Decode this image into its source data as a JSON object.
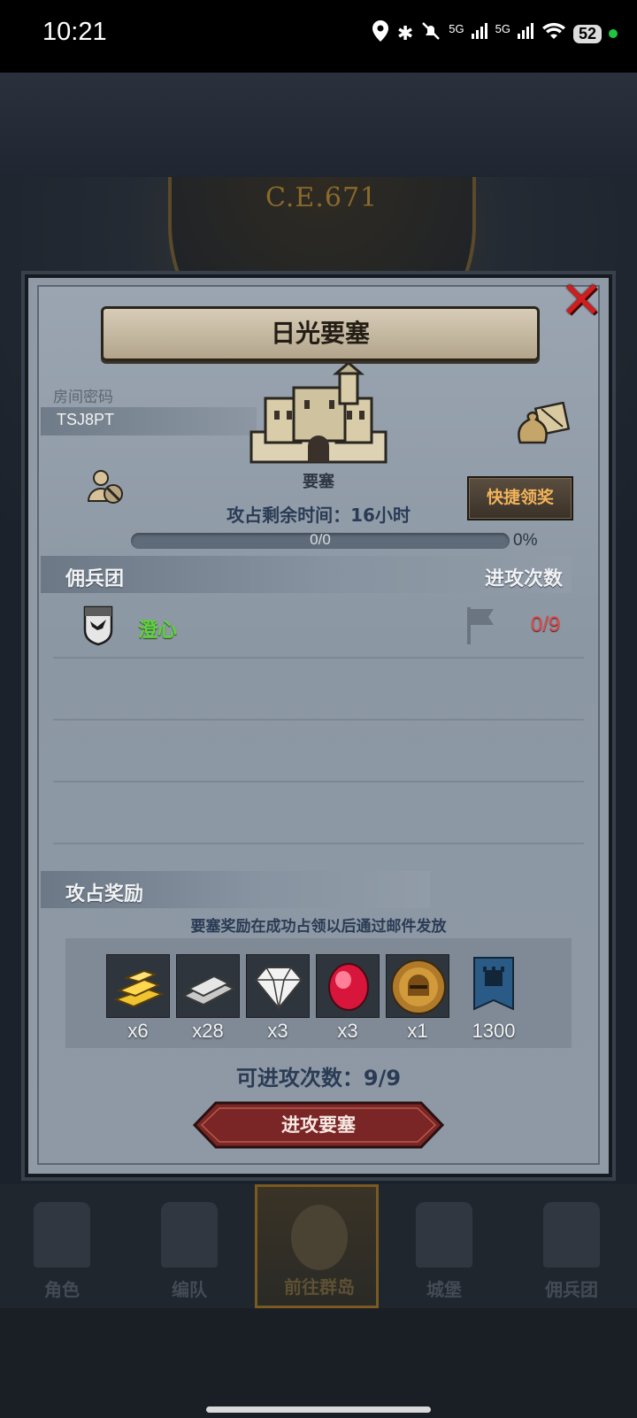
{
  "status_bar": {
    "time": "10:21",
    "battery": "52",
    "signal_label": "5G"
  },
  "background": {
    "era_label": "C.E.671"
  },
  "panel": {
    "title": "日光要塞",
    "room_password_label": "房间密码",
    "room_password": "TSJ8PT",
    "building_name": "要塞",
    "quick_claim_label": "快捷领奖",
    "time_left_label": "攻占剩余时间：16小时",
    "progress_text": "0/0",
    "progress_fraction": 0,
    "progress_percent": "0%",
    "mercenary_header": "佣兵团",
    "attack_count_header": "进攻次数",
    "guild": {
      "name": "澄心",
      "attacks": "0/9"
    },
    "reward_header": "攻占奖励",
    "reward_note": "要塞奖励在成功占领以后通过邮件发放",
    "rewards": [
      {
        "icon": "gold-bar-icon",
        "qty": "x6"
      },
      {
        "icon": "iron-ingot-icon",
        "qty": "x28"
      },
      {
        "icon": "diamond-icon",
        "qty": "x3"
      },
      {
        "icon": "ruby-icon",
        "qty": "x3"
      },
      {
        "icon": "knight-medal-icon",
        "qty": "x1"
      },
      {
        "icon": "guild-banner-icon",
        "qty": "1300"
      }
    ],
    "remaining_attacks": "可进攻次数：9/9",
    "attack_button": "进攻要塞"
  },
  "nav": {
    "items": [
      {
        "label": "角色"
      },
      {
        "label": "编队"
      },
      {
        "label": "前往群岛"
      },
      {
        "label": "城堡"
      },
      {
        "label": "佣兵团"
      }
    ]
  },
  "colors": {
    "guild_name": "#5fd33c",
    "attack_count": "#e04a4a",
    "quick_button_text": "#f1b35a",
    "close_icon": "#d11d1d"
  }
}
